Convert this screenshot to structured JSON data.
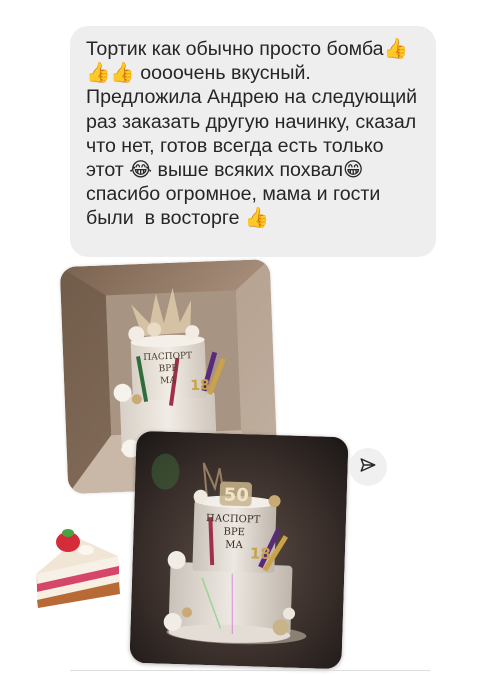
{
  "message": {
    "text": "Тортик как обычно просто бомба👍👍👍 оооочень вкусный. Предложила Андрею на следующий раз заказать другую начинку, сказал что нет, готов всегда есть только этот 😂 выше всяких похвал😁 спасибо огромное, мама и гости были  в восторге 👍"
  },
  "photos": [
    {
      "topper_text": "ПАСПОРТ\nВРЕ\nМА\n18"
    },
    {
      "topper_text": "ПАСПОРТ\nВРЕ\nМА\n18",
      "number_topper": "50"
    }
  ],
  "icons": {
    "share": "paper-plane-icon",
    "sticker": "cake-slice-sticker"
  }
}
